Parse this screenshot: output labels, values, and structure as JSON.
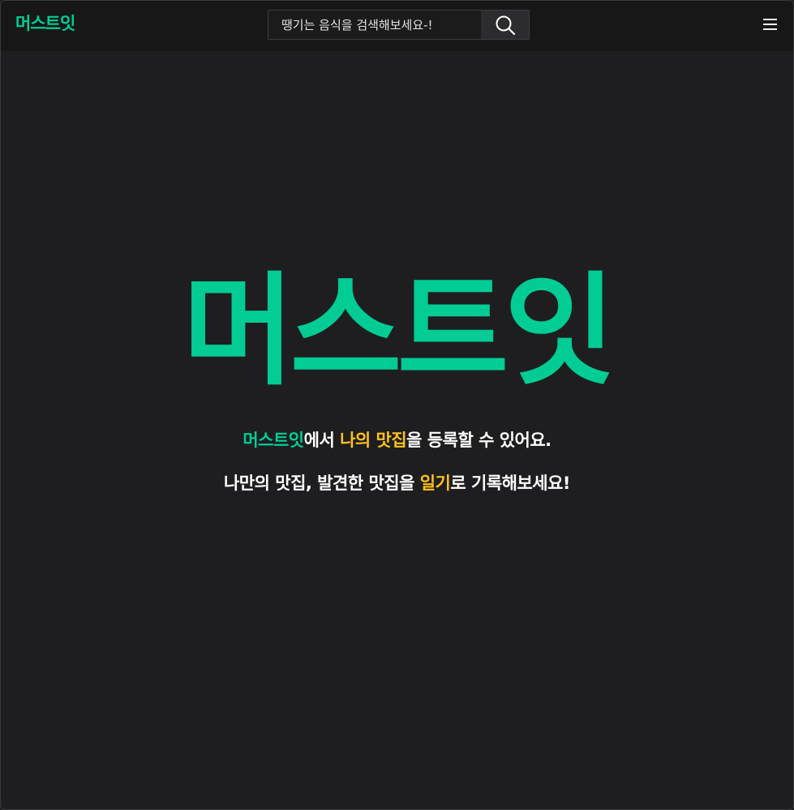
{
  "header": {
    "logo": "머스트잇",
    "search": {
      "placeholder": "땡기는 음식을 검색해보세요-!",
      "icon": "search-icon"
    },
    "menu_icon": "hamburger-menu-icon"
  },
  "hero": {
    "title": "머스트잇",
    "line1": {
      "brand": "머스트잇",
      "text_a": "에서 ",
      "highlight": "나의 맛집",
      "text_b": "을 등록할 수 있어요."
    },
    "line2": {
      "text_a": "나만의 맛집, 발견한 맛집을 ",
      "highlight": "일기",
      "text_b": "로 기록해보세요!"
    }
  },
  "colors": {
    "brand_green": "#00cc94",
    "highlight_yellow": "#ffc21a",
    "background": "#1e1e20",
    "header_bg": "#171717"
  }
}
